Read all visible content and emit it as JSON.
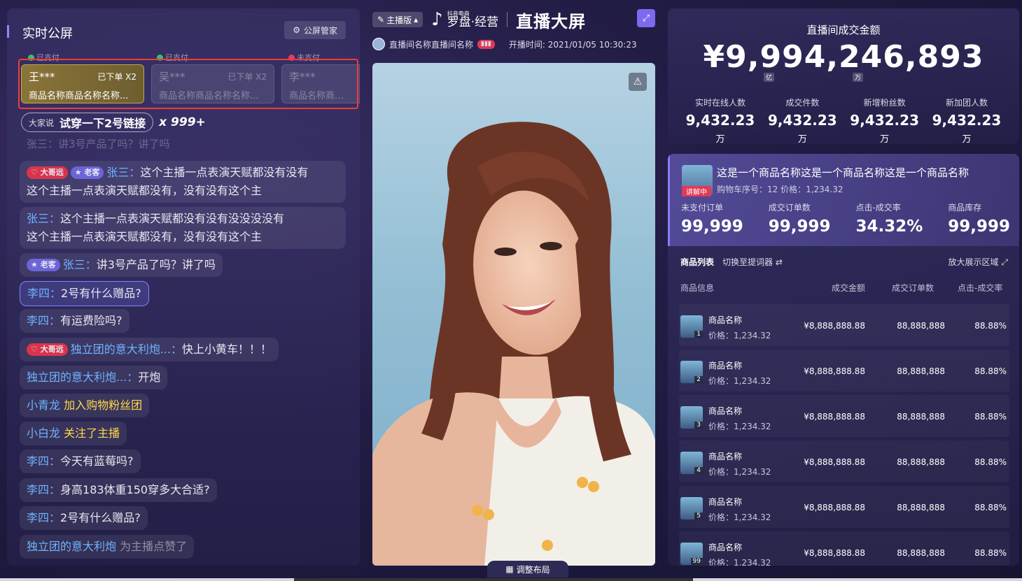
{
  "left": {
    "title": "实时公屏",
    "screen_mgr": "公屏管家",
    "statuses": [
      "已支付",
      "已支付",
      "未支付"
    ],
    "orders": [
      {
        "name": "王***",
        "tag": "已下单 X2",
        "product": "商品名称商品名称名称..."
      },
      {
        "name": "吴***",
        "tag": "已下单 X2",
        "product": "商品名称商品名称名称..."
      },
      {
        "name": "李***",
        "tag": "",
        "product": "商品名称商品名"
      }
    ],
    "hot": {
      "prefix": "大家说",
      "text": "试穿一下2号链接",
      "count": "x 999+"
    },
    "faded": "张三：讲3号产品了吗？讲了吗",
    "chats": [
      {
        "badges": [
          "大哥远",
          "老客"
        ],
        "user": "张三：",
        "text": "这个主播一点表演天赋都没有没有",
        "text2": "这个主播一点表演天赋都没有，没有没有这个主"
      },
      {
        "user": "张三：",
        "text": "这个主播一点表演天赋都没有没有没没没没有",
        "text2": "这个主播一点表演天赋都没有，没有没有这个主"
      },
      {
        "badges": [
          "老客"
        ],
        "user": "张三：",
        "text": "讲3号产品了吗？讲了吗"
      },
      {
        "user": "李四：",
        "text": "2号有什么赠品?"
      },
      {
        "user": "李四：",
        "text": "有运费险吗?"
      },
      {
        "badges": [
          "大哥远"
        ],
        "user": "独立团的意大利炮...：",
        "text": "快上小黄车！！！"
      },
      {
        "user": "独立团的意大利炮...：",
        "text": "开炮"
      },
      {
        "user": "小青龙",
        "text": "加入购物粉丝团"
      },
      {
        "user": "小白龙",
        "text": "关注了主播"
      },
      {
        "user": "李四：",
        "text": "今天有蓝莓吗?"
      },
      {
        "user": "李四：",
        "text": "身高183体重150穿多大合适?"
      },
      {
        "user": "李四：",
        "text": "2号有什么赠品?"
      },
      {
        "user": "独立团的意大利炮",
        "text": "为主播点赞了"
      }
    ]
  },
  "center": {
    "anchor_version": "主播版",
    "brand_top": "抖音电商",
    "brand_main": "罗盘·经营",
    "title": "直播大屏",
    "room_name": "直播间名称直播间名称",
    "start_time": "开播时间: 2021/01/05 10:30:23",
    "adjust_layout": "调整布局"
  },
  "right": {
    "gmv_label": "直播间成交金额",
    "gmv": "¥9,994,246,893",
    "unit_yi": "亿",
    "unit_wan": "万",
    "stats": [
      {
        "label": "实时在线人数",
        "value": "9,432.23",
        "unit": "万"
      },
      {
        "label": "成交件数",
        "value": "9,432.23",
        "unit": "万"
      },
      {
        "label": "新增粉丝数",
        "value": "9,432.23",
        "unit": "万"
      },
      {
        "label": "新加团人数",
        "value": "9,432.23",
        "unit": "万"
      }
    ],
    "current": {
      "status": "讲解中",
      "name": "这是一个商品名称这是一个商品名称这是一个商品名称",
      "meta": "购物车序号：12   价格：1,234.32",
      "stats": [
        {
          "label": "未支付订单",
          "value": "99,999"
        },
        {
          "label": "成交订单数",
          "value": "99,999"
        },
        {
          "label": "点击-成交率",
          "value": "34.32%"
        },
        {
          "label": "商品库存",
          "value": "99,999"
        }
      ]
    },
    "list_title": "商品列表",
    "switch": "切换至提词器",
    "expand": "放大展示区域",
    "columns": [
      "商品信息",
      "成交金额",
      "成交订单数",
      "点击-成交率"
    ],
    "products": [
      {
        "rank": "1",
        "name": "商品名称",
        "price": "价格：1,234.32",
        "amount": "¥8,888,888.88",
        "orders": "88,888,888",
        "rate": "88.88%"
      },
      {
        "rank": "2",
        "name": "商品名称",
        "price": "价格：1,234.32",
        "amount": "¥8,888,888.88",
        "orders": "88,888,888",
        "rate": "88.88%"
      },
      {
        "rank": "3",
        "name": "商品名称",
        "price": "价格：1,234.32",
        "amount": "¥8,888,888.88",
        "orders": "88,888,888",
        "rate": "88.88%"
      },
      {
        "rank": "4",
        "name": "商品名称",
        "price": "价格：1,234.32",
        "amount": "¥8,888,888.88",
        "orders": "88,888,888",
        "rate": "88.88%"
      },
      {
        "rank": "5",
        "name": "商品名称",
        "price": "价格：1,234.32",
        "amount": "¥8,888,888.88",
        "orders": "88,888,888",
        "rate": "88.88%"
      },
      {
        "rank": "99",
        "name": "商品名称",
        "price": "价格：1,234.32",
        "amount": "¥8,888,888.88",
        "orders": "88,888,888",
        "rate": "88.88%"
      }
    ]
  },
  "colors": {
    "accent": "#7c6af0",
    "highlight": "#ef3b3b",
    "gold": "#8a7538",
    "user_blue": "#6fb3ff",
    "action_yellow": "#ffd84a"
  }
}
